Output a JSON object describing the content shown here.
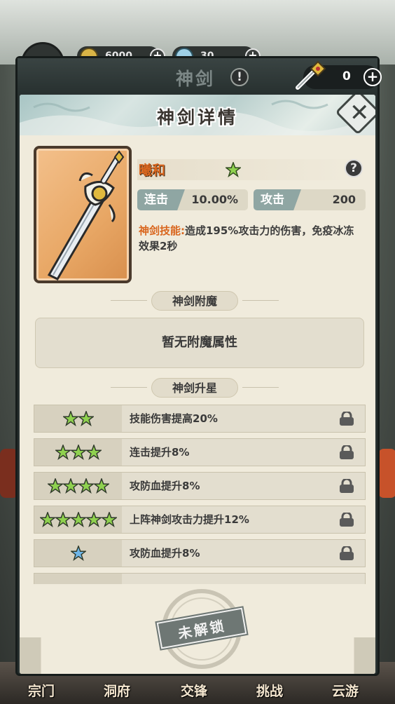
{
  "top_resources": [
    {
      "value": "6000",
      "icon": "copper-coin-icon"
    },
    {
      "value": "30",
      "icon": "spirit-gem-icon"
    }
  ],
  "titlebar": {
    "title": "神剑",
    "help": "!",
    "sword_count": "0",
    "plus": "+"
  },
  "dialog": {
    "title": "神剑详情",
    "close": "✕"
  },
  "sword": {
    "name": "曦和",
    "star_count": 1,
    "help": "?",
    "stats": [
      {
        "label": "连击",
        "value": "10.00%"
      },
      {
        "label": "攻击",
        "value": "200"
      }
    ],
    "skill_label": "神剑技能:",
    "skill_text": "造成195%攻击力的伤害，免疫冰冻效果2秒"
  },
  "enchant": {
    "section_title": "神剑附魔",
    "empty_text": "暂无附魔属性"
  },
  "star_up": {
    "section_title": "神剑升星",
    "rows": [
      {
        "stars": 2,
        "star_color": "green",
        "text": "技能伤害提高20%"
      },
      {
        "stars": 3,
        "star_color": "green",
        "text": "连击提升8%"
      },
      {
        "stars": 4,
        "star_color": "green",
        "text": "攻防血提升8%"
      },
      {
        "stars": 5,
        "star_color": "green",
        "text": "上阵神剑攻击力提升12%"
      },
      {
        "stars": 1,
        "star_color": "blue",
        "text": "攻防血提升8%"
      }
    ]
  },
  "unlock_stamp": "未解锁",
  "bottom_nav": [
    "宗门",
    "洞府",
    "交锋",
    "挑战",
    "云游"
  ],
  "colors": {
    "accent_orange": "#d9661e",
    "star_green": "#8fd14f",
    "star_blue": "#6fb6e8",
    "panel_dark": "#283130",
    "paper": "#f0ebdc"
  }
}
